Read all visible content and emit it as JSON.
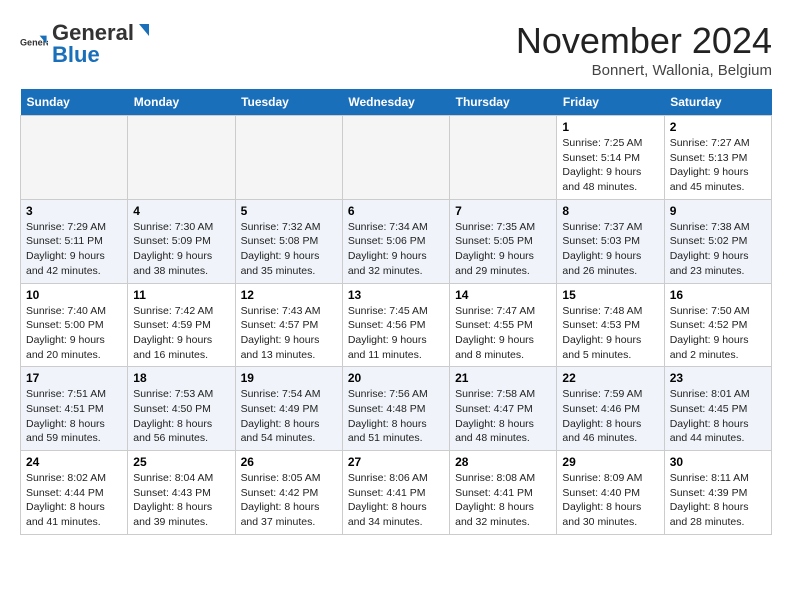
{
  "header": {
    "logo_line1": "General",
    "logo_line2": "Blue",
    "month_title": "November 2024",
    "subtitle": "Bonnert, Wallonia, Belgium"
  },
  "days_of_week": [
    "Sunday",
    "Monday",
    "Tuesday",
    "Wednesday",
    "Thursday",
    "Friday",
    "Saturday"
  ],
  "weeks": [
    [
      {
        "day": "",
        "info": ""
      },
      {
        "day": "",
        "info": ""
      },
      {
        "day": "",
        "info": ""
      },
      {
        "day": "",
        "info": ""
      },
      {
        "day": "",
        "info": ""
      },
      {
        "day": "1",
        "info": "Sunrise: 7:25 AM\nSunset: 5:14 PM\nDaylight: 9 hours and 48 minutes."
      },
      {
        "day": "2",
        "info": "Sunrise: 7:27 AM\nSunset: 5:13 PM\nDaylight: 9 hours and 45 minutes."
      }
    ],
    [
      {
        "day": "3",
        "info": "Sunrise: 7:29 AM\nSunset: 5:11 PM\nDaylight: 9 hours and 42 minutes."
      },
      {
        "day": "4",
        "info": "Sunrise: 7:30 AM\nSunset: 5:09 PM\nDaylight: 9 hours and 38 minutes."
      },
      {
        "day": "5",
        "info": "Sunrise: 7:32 AM\nSunset: 5:08 PM\nDaylight: 9 hours and 35 minutes."
      },
      {
        "day": "6",
        "info": "Sunrise: 7:34 AM\nSunset: 5:06 PM\nDaylight: 9 hours and 32 minutes."
      },
      {
        "day": "7",
        "info": "Sunrise: 7:35 AM\nSunset: 5:05 PM\nDaylight: 9 hours and 29 minutes."
      },
      {
        "day": "8",
        "info": "Sunrise: 7:37 AM\nSunset: 5:03 PM\nDaylight: 9 hours and 26 minutes."
      },
      {
        "day": "9",
        "info": "Sunrise: 7:38 AM\nSunset: 5:02 PM\nDaylight: 9 hours and 23 minutes."
      }
    ],
    [
      {
        "day": "10",
        "info": "Sunrise: 7:40 AM\nSunset: 5:00 PM\nDaylight: 9 hours and 20 minutes."
      },
      {
        "day": "11",
        "info": "Sunrise: 7:42 AM\nSunset: 4:59 PM\nDaylight: 9 hours and 16 minutes."
      },
      {
        "day": "12",
        "info": "Sunrise: 7:43 AM\nSunset: 4:57 PM\nDaylight: 9 hours and 13 minutes."
      },
      {
        "day": "13",
        "info": "Sunrise: 7:45 AM\nSunset: 4:56 PM\nDaylight: 9 hours and 11 minutes."
      },
      {
        "day": "14",
        "info": "Sunrise: 7:47 AM\nSunset: 4:55 PM\nDaylight: 9 hours and 8 minutes."
      },
      {
        "day": "15",
        "info": "Sunrise: 7:48 AM\nSunset: 4:53 PM\nDaylight: 9 hours and 5 minutes."
      },
      {
        "day": "16",
        "info": "Sunrise: 7:50 AM\nSunset: 4:52 PM\nDaylight: 9 hours and 2 minutes."
      }
    ],
    [
      {
        "day": "17",
        "info": "Sunrise: 7:51 AM\nSunset: 4:51 PM\nDaylight: 8 hours and 59 minutes."
      },
      {
        "day": "18",
        "info": "Sunrise: 7:53 AM\nSunset: 4:50 PM\nDaylight: 8 hours and 56 minutes."
      },
      {
        "day": "19",
        "info": "Sunrise: 7:54 AM\nSunset: 4:49 PM\nDaylight: 8 hours and 54 minutes."
      },
      {
        "day": "20",
        "info": "Sunrise: 7:56 AM\nSunset: 4:48 PM\nDaylight: 8 hours and 51 minutes."
      },
      {
        "day": "21",
        "info": "Sunrise: 7:58 AM\nSunset: 4:47 PM\nDaylight: 8 hours and 48 minutes."
      },
      {
        "day": "22",
        "info": "Sunrise: 7:59 AM\nSunset: 4:46 PM\nDaylight: 8 hours and 46 minutes."
      },
      {
        "day": "23",
        "info": "Sunrise: 8:01 AM\nSunset: 4:45 PM\nDaylight: 8 hours and 44 minutes."
      }
    ],
    [
      {
        "day": "24",
        "info": "Sunrise: 8:02 AM\nSunset: 4:44 PM\nDaylight: 8 hours and 41 minutes."
      },
      {
        "day": "25",
        "info": "Sunrise: 8:04 AM\nSunset: 4:43 PM\nDaylight: 8 hours and 39 minutes."
      },
      {
        "day": "26",
        "info": "Sunrise: 8:05 AM\nSunset: 4:42 PM\nDaylight: 8 hours and 37 minutes."
      },
      {
        "day": "27",
        "info": "Sunrise: 8:06 AM\nSunset: 4:41 PM\nDaylight: 8 hours and 34 minutes."
      },
      {
        "day": "28",
        "info": "Sunrise: 8:08 AM\nSunset: 4:41 PM\nDaylight: 8 hours and 32 minutes."
      },
      {
        "day": "29",
        "info": "Sunrise: 8:09 AM\nSunset: 4:40 PM\nDaylight: 8 hours and 30 minutes."
      },
      {
        "day": "30",
        "info": "Sunrise: 8:11 AM\nSunset: 4:39 PM\nDaylight: 8 hours and 28 minutes."
      }
    ]
  ]
}
